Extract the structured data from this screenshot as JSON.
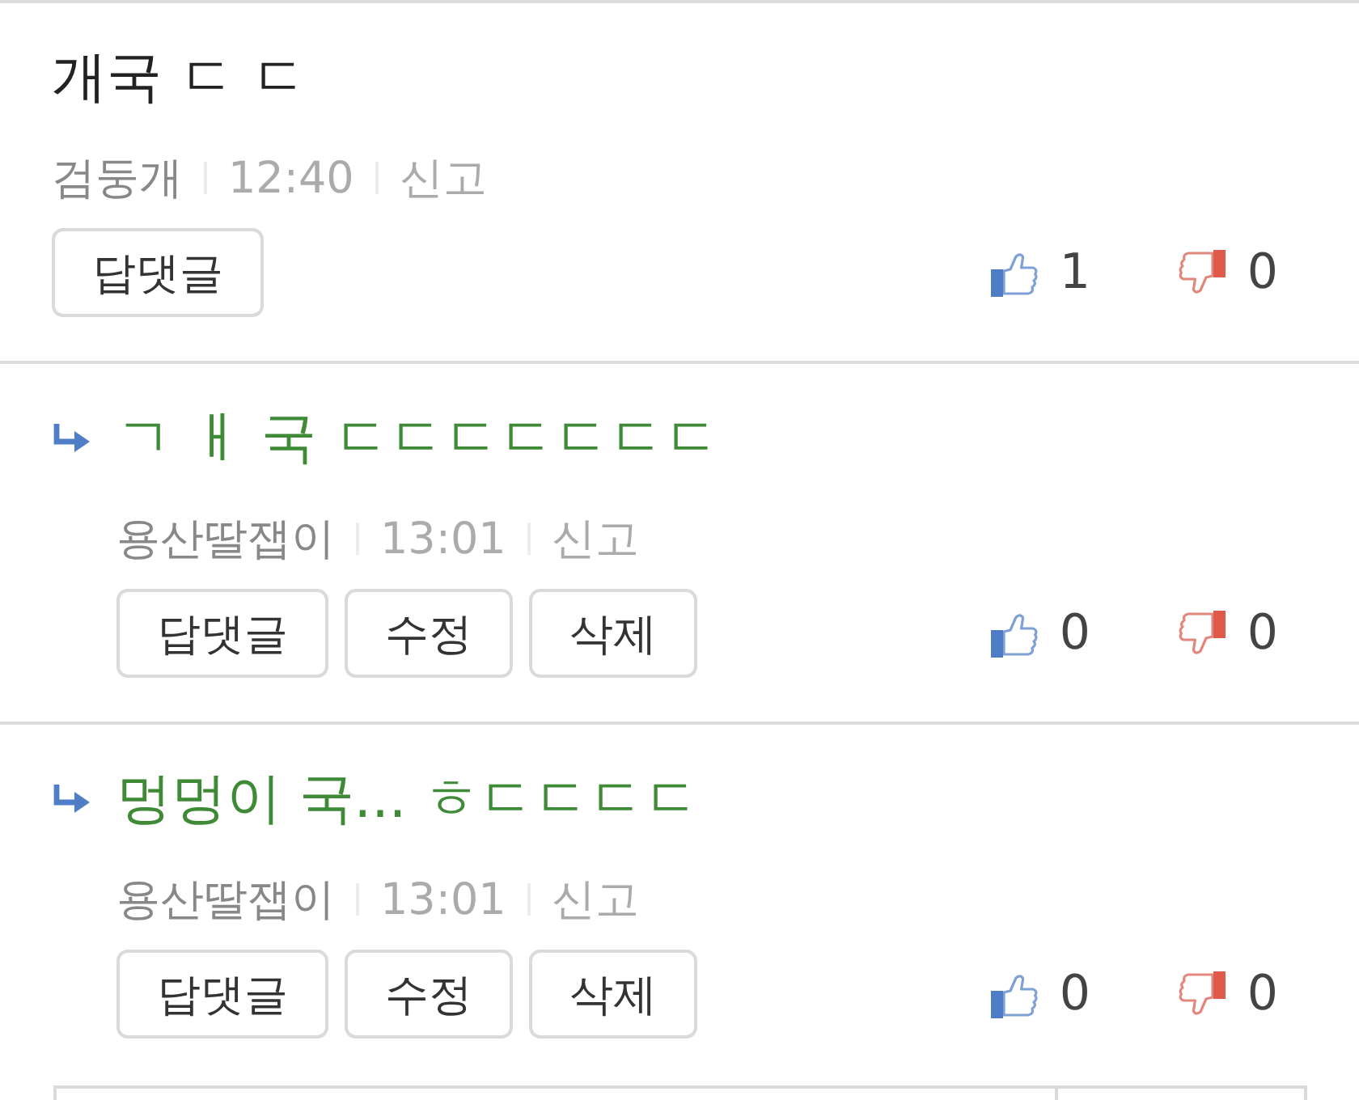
{
  "comments": [
    {
      "kind": "comment",
      "title": "개국 ㄷ ㄷ",
      "author": "검둥개",
      "time": "12:40",
      "report": "신고",
      "buttons": [
        "답댓글"
      ],
      "likes": "1",
      "dislikes": "0"
    },
    {
      "kind": "reply",
      "title": "ㄱ ㅐ 국 ㄷㄷㄷㄷㄷㄷㄷ",
      "author": "용산딸잽이",
      "time": "13:01",
      "report": "신고",
      "buttons": [
        "답댓글",
        "수정",
        "삭제"
      ],
      "likes": "0",
      "dislikes": "0"
    },
    {
      "kind": "reply",
      "title": "멍멍이 국... ㅎㄷㄷㄷㄷ",
      "author": "용산딸잽이",
      "time": "13:01",
      "report": "신고",
      "buttons": [
        "답댓글",
        "수정",
        "삭제"
      ],
      "likes": "0",
      "dislikes": "0"
    }
  ]
}
